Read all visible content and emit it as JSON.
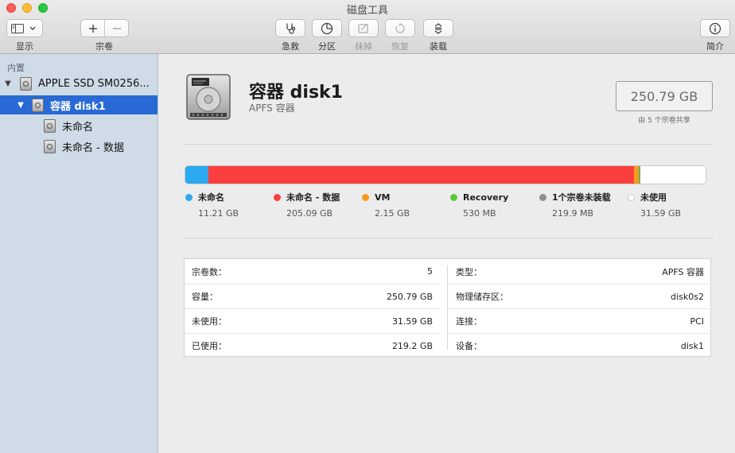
{
  "window": {
    "title": "磁盘工具"
  },
  "toolbar": {
    "view_label": "显示",
    "volume_label": "宗卷",
    "firstaid_label": "急救",
    "partition_label": "分区",
    "erase_label": "抹掉",
    "restore_label": "恢复",
    "mount_label": "装载",
    "info_label": "简介"
  },
  "sidebar": {
    "section": "内置",
    "items": [
      {
        "label": "APPLE SSD SM0256..."
      },
      {
        "label": "容器 disk1"
      },
      {
        "label": "未命名"
      },
      {
        "label": "未命名 - 数据"
      }
    ]
  },
  "main": {
    "title": "容器 disk1",
    "subtitle": "APFS 容器",
    "capacity": "250.79 GB",
    "capacity_note": "由 5 个宗卷共享"
  },
  "usage": {
    "segments": [
      {
        "name": "未命名",
        "size": "11.21 GB",
        "color": "#2aa8f0",
        "fraction": 0.0447
      },
      {
        "name": "未命名 - 数据",
        "size": "205.09 GB",
        "color": "#fb3f3f",
        "fraction": 0.8178
      },
      {
        "name": "VM",
        "size": "2.15 GB",
        "color": "#f79a1d",
        "fraction": 0.0086
      },
      {
        "name": "Recovery",
        "size": "530 MB",
        "color": "#5bc83c",
        "fraction": 0.0021
      },
      {
        "name": "1个宗卷未装载",
        "size": "219.9 MB",
        "color": "#8e8e8e",
        "fraction": 0.0009
      },
      {
        "name": "未使用",
        "size": "31.59 GB",
        "color": "#ffffff",
        "fraction": 0.126
      }
    ]
  },
  "info": {
    "left": [
      {
        "label": "宗卷数：",
        "value": "5"
      },
      {
        "label": "容量：",
        "value": "250.79 GB"
      },
      {
        "label": "未使用：",
        "value": "31.59 GB"
      },
      {
        "label": "已使用：",
        "value": "219.2 GB"
      }
    ],
    "right": [
      {
        "label": "类型：",
        "value": "APFS 容器"
      },
      {
        "label": "物理储存区：",
        "value": "disk0s2"
      },
      {
        "label": "连接：",
        "value": "PCI"
      },
      {
        "label": "设备：",
        "value": "disk1"
      }
    ]
  }
}
